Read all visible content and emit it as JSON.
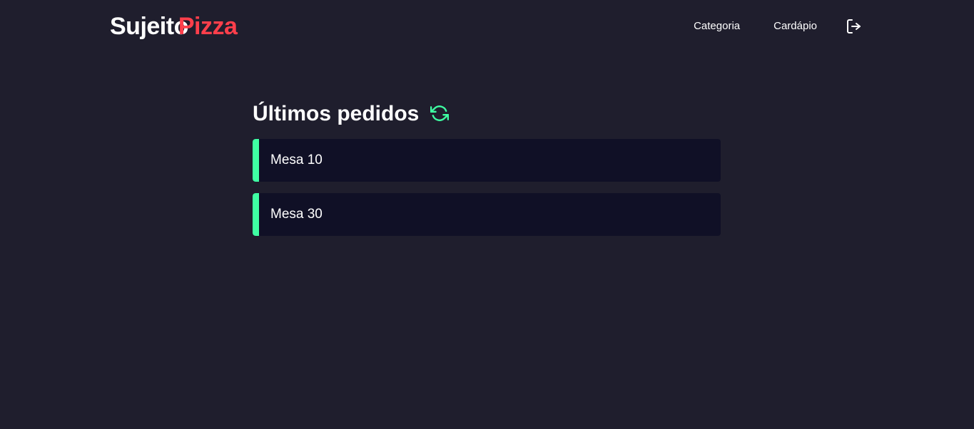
{
  "header": {
    "logo_part1": "Sujeito",
    "logo_part2": "Pizza",
    "nav": [
      {
        "label": "Categoria"
      },
      {
        "label": "Cardápio"
      }
    ],
    "logout_icon": "logout-icon"
  },
  "main": {
    "title": "Últimos pedidos",
    "refresh_icon": "refresh-icon",
    "orders": [
      {
        "label": "Mesa 10"
      },
      {
        "label": "Mesa 30"
      }
    ]
  },
  "colors": {
    "background": "#1f1e2d",
    "card": "#101026",
    "accent_green": "#3fffa3",
    "brand_red": "#ff3f4b",
    "text": "#ffffff"
  }
}
